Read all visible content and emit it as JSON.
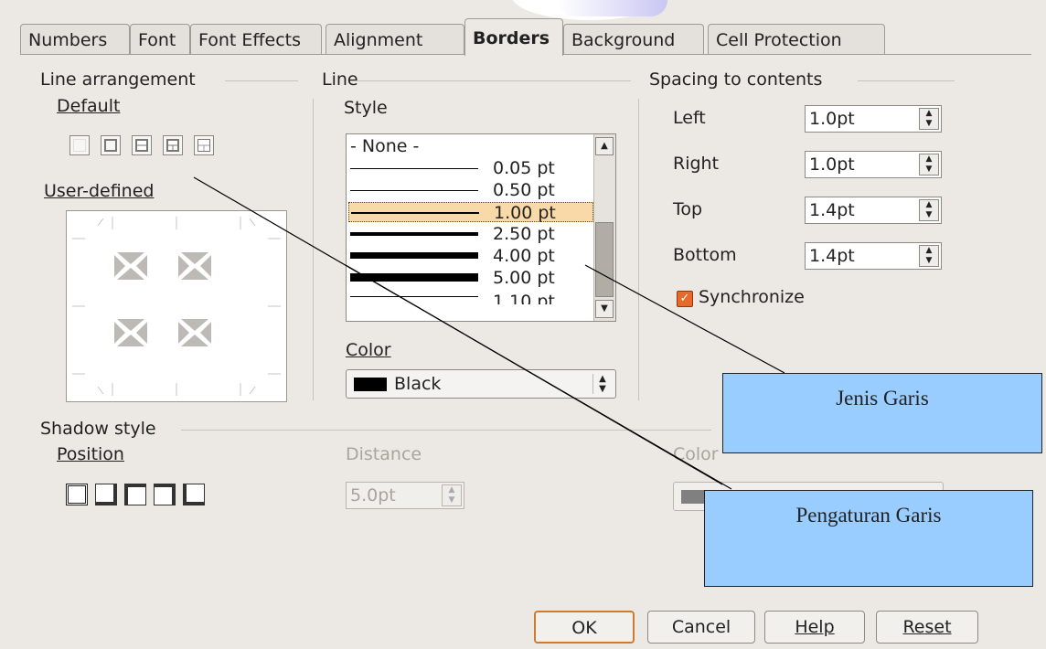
{
  "tabs": [
    "Numbers",
    "Font",
    "Font Effects",
    "Alignment",
    "Borders",
    "Background",
    "Cell Protection"
  ],
  "active_tab": "Borders",
  "line_arrangement": {
    "title": "Line arrangement",
    "default_label": "Default",
    "user_defined_label": "User-defined"
  },
  "line": {
    "title": "Line",
    "style_label": "Style",
    "styles": [
      "- None -",
      "0.05 pt",
      "0.50 pt",
      "1.00 pt",
      "2.50 pt",
      "4.00 pt",
      "5.00 pt",
      "1.10 pt"
    ],
    "selected_style": "1.00 pt",
    "color_label": "Color",
    "color_value": "Black",
    "color_swatch": "#000000"
  },
  "spacing": {
    "title": "Spacing to contents",
    "left_label": "Left",
    "left_value": "1.0pt",
    "right_label": "Right",
    "right_value": "1.0pt",
    "top_label": "Top",
    "top_value": "1.4pt",
    "bottom_label": "Bottom",
    "bottom_value": "1.4pt",
    "synchronize_label": "Synchronize",
    "synchronize_checked": true
  },
  "shadow": {
    "title": "Shadow style",
    "position_label": "Position",
    "distance_label": "Distance",
    "distance_value": "5.0pt",
    "color_label": "Color"
  },
  "buttons": {
    "ok": "OK",
    "cancel": "Cancel",
    "help": "Help",
    "reset": "Reset"
  },
  "callouts": {
    "line_type": "Jenis Garis",
    "line_setting": "Pengaturan Garis"
  },
  "colors": {
    "accent": "#e86a2a",
    "callout_bg": "#99ccff",
    "selection": "#f9d9a8"
  }
}
